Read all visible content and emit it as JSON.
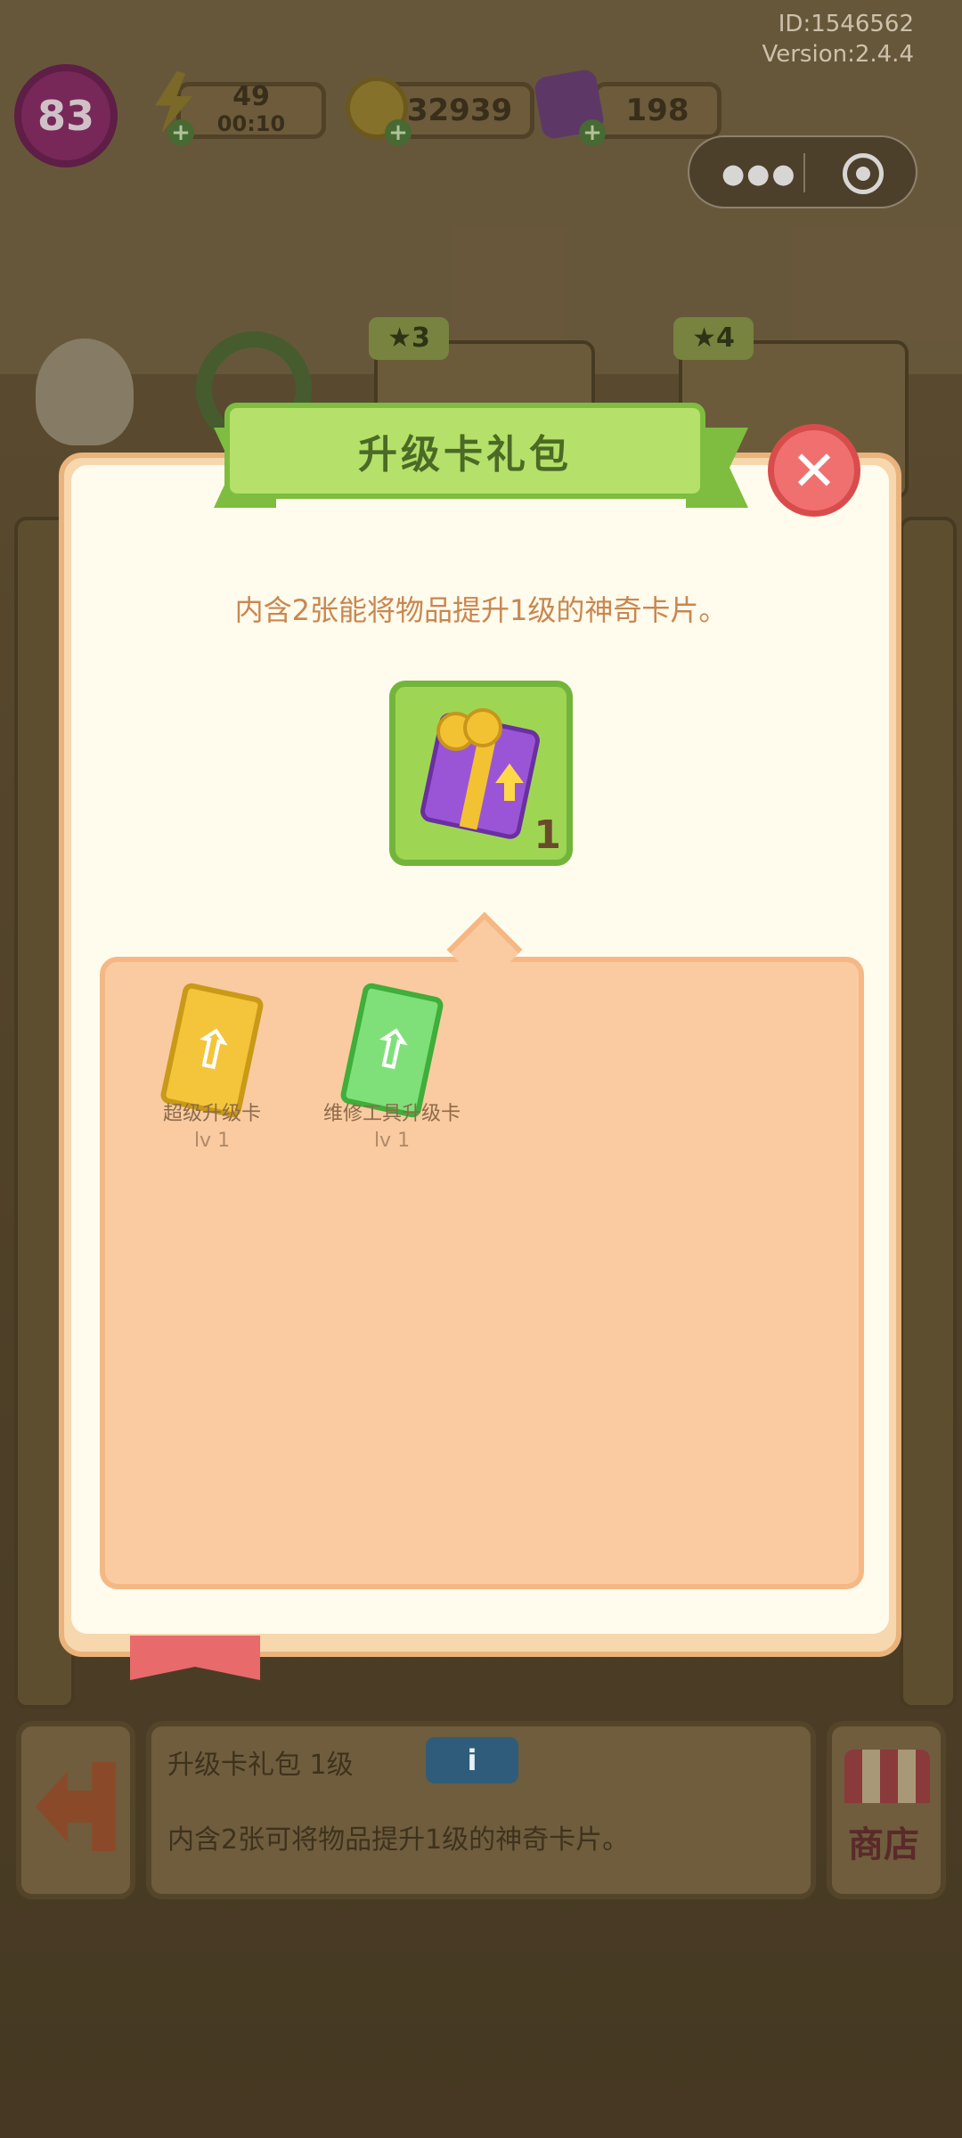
{
  "header": {
    "id_text": "ID:1546562",
    "version_text": "Version:2.4.4"
  },
  "hud": {
    "level": "83",
    "energy": "49",
    "energy_timer": "00:10",
    "coins": "32939",
    "gems": "198"
  },
  "modal": {
    "title": "升级卡礼包",
    "description": "内含2张能将物品提升1级的神奇卡片。",
    "gift_count": "1",
    "cards": [
      {
        "name": "超级升级卡",
        "level": "lv 1"
      },
      {
        "name": "维修工具升级卡",
        "level": "lv 1"
      }
    ]
  },
  "background": {
    "badge_left": "3",
    "badge_right": "4"
  },
  "bottom_info": {
    "title": "升级卡礼包  1级",
    "info_icon": "i",
    "description": "内含2张可将物品提升1级的神奇卡片。",
    "shop_label": "商店"
  },
  "colors": {
    "modal_bg": "#fffbed",
    "panel_bg": "#facba0",
    "banner_green": "#b5e06a",
    "close_red": "#f07070",
    "text_orange": "#c8874f"
  }
}
